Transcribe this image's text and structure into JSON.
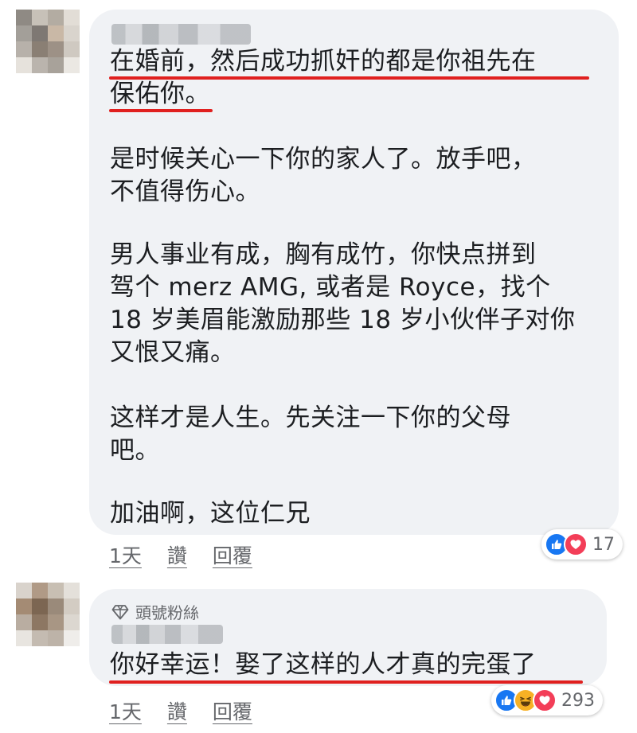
{
  "comments": [
    {
      "paragraphs": [
        [
          "在婚前，然后成功抓奸的都是你祖先在",
          "保佑你。"
        ],
        [
          "是时候关心一下你的家人了。放手吧，",
          "不值得伤心。"
        ],
        [
          "男人事业有成，胸有成竹，你快点拼到",
          "驾个 merz AMG, 或者是 Royce，找个",
          "18 岁美眉能激励那些 18 岁小伙伴子对你",
          "又恨又痛。"
        ],
        [
          "这样才是人生。先关注一下你的父母",
          "吧。"
        ],
        [
          "加油啊，这位仁兄"
        ]
      ],
      "time": "1天",
      "like_label": "讚",
      "reply_label": "回覆",
      "reaction_count": "17",
      "reactions": [
        "like-icon",
        "love-icon"
      ]
    },
    {
      "badge": "頭號粉絲",
      "text": "你好幸运！娶了这样的人才真的完蛋了",
      "time": "1天",
      "like_label": "讚",
      "reply_label": "回覆",
      "reaction_count": "293",
      "reactions": [
        "like-icon",
        "haha-icon",
        "love-icon"
      ]
    }
  ],
  "colors": {
    "bubble": "#f0f2f5",
    "underline": "#e0201f",
    "like": "#1877f2",
    "love": "#f33e58",
    "haha": "#f7b125",
    "meta": "#65676b"
  }
}
